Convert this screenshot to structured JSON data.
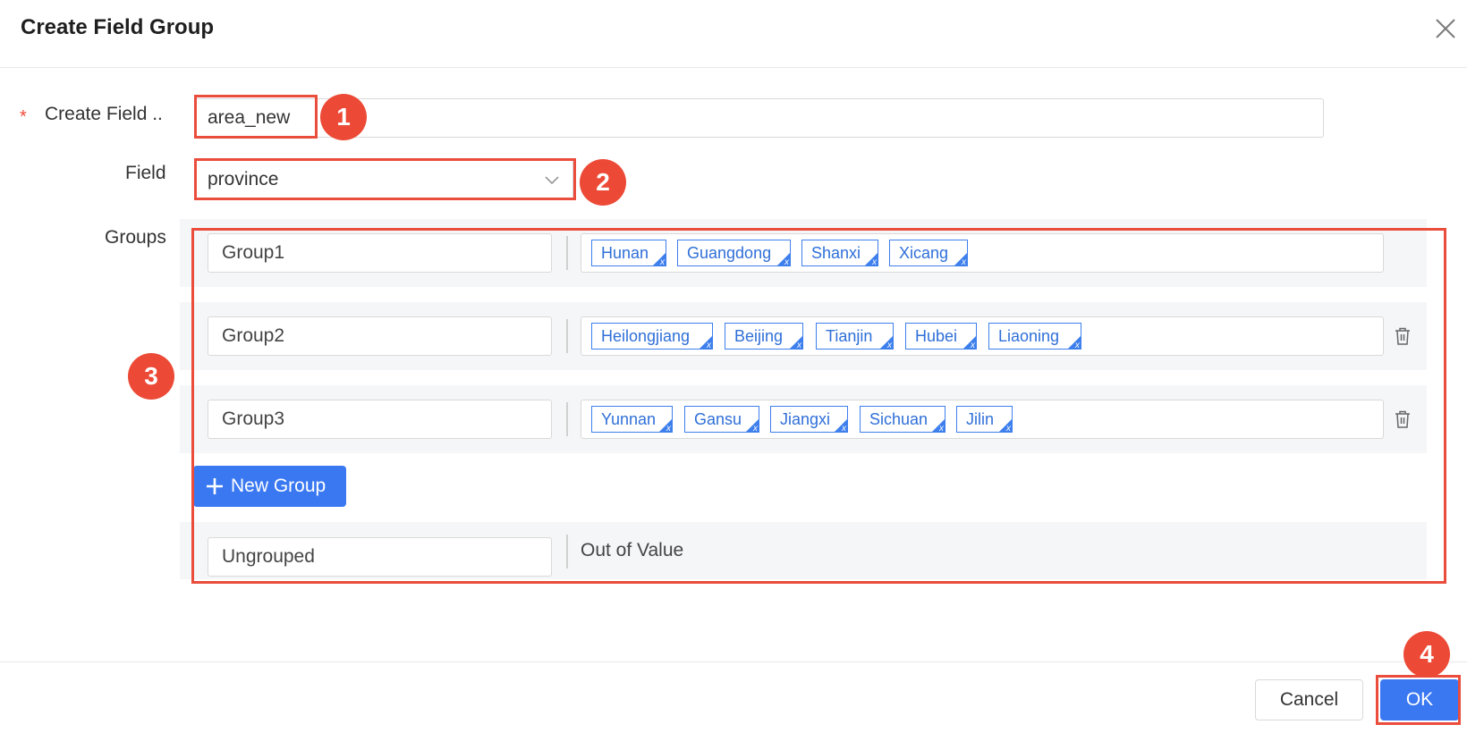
{
  "dialog": {
    "title": "Create Field Group",
    "close_icon": "close-icon"
  },
  "form": {
    "name_label": "Create Field ..",
    "name_value": "area_new",
    "field_label": "Field",
    "field_value": "province",
    "groups_label": "Groups"
  },
  "groups": [
    {
      "name": "Group1",
      "tags": [
        "Hunan",
        "Guangdong",
        "Shanxi",
        "Xicang"
      ]
    },
    {
      "name": "Group2",
      "tags": [
        "Heilongjiang",
        "Beijing",
        "Tianjin",
        "Hubei",
        "Liaoning"
      ]
    },
    {
      "name": "Group3",
      "tags": [
        "Yunnan",
        "Gansu",
        "Jiangxi",
        "Sichuan",
        "Jilin"
      ]
    }
  ],
  "new_group_label": "New Group",
  "ungrouped": {
    "name": "Ungrouped",
    "value": "Out of Value"
  },
  "footer": {
    "cancel_label": "Cancel",
    "ok_label": "OK"
  },
  "annotations": [
    "1",
    "2",
    "3",
    "4"
  ],
  "colors": {
    "accent": "#3a78f2",
    "highlight": "#ea4d3c",
    "row_bg": "#f5f6f8"
  }
}
